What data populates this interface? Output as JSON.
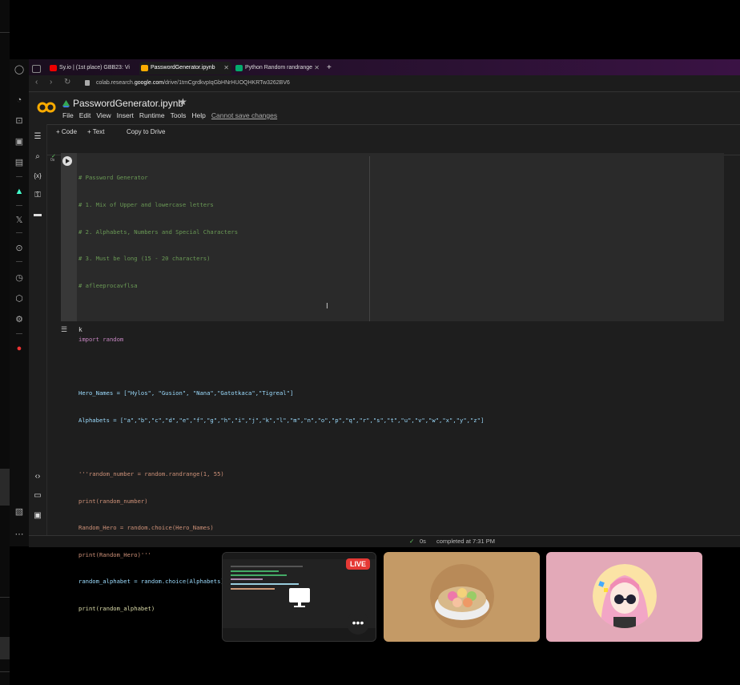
{
  "tabs": [
    {
      "label": "Sy.io | (1st place) GBB23: Vi",
      "active": false
    },
    {
      "label": "PasswordGenerator.ipynb",
      "active": true
    },
    {
      "label": "Python Random randrange",
      "active": false
    }
  ],
  "url": {
    "host_prefix": "colab.research.",
    "host_bold": "google.com",
    "path": "/drive/1tmCgrdkvpIqGbHNrHUOQHKRTw3262BV6"
  },
  "notebook": {
    "title": "PasswordGenerator.ipynb",
    "menu": [
      "File",
      "Edit",
      "View",
      "Insert",
      "Runtime",
      "Tools",
      "Help"
    ],
    "unsaved": "Cannot save changes",
    "toolbar": {
      "code": "+ Code",
      "text": "+ Text",
      "copy": "Copy to Drive"
    },
    "exec_count": "0s",
    "code_lines": [
      "# Password Generator",
      "# 1. Mix of Upper and lowercase letters",
      "# 2. Alphabets, Numbers and Special Characters",
      "# 3. Must be long (15 - 20 characters)",
      "# afleeprocavflsa",
      "",
      "import random",
      "",
      "Hero_Names = [\"Hylos\", \"Gusion\", \"Nana\",\"Gatotkaca\",\"Tigreal\"]",
      "Alphabets = [\"a\",\"b\",\"c\",\"d\",\"e\",\"f\",\"g\",\"h\",\"i\",\"j\",\"k\",\"l\",\"m\",\"n\",\"o\",\"p\",\"q\",\"r\",\"s\",\"t\",\"u\",\"v\",\"w\",\"x\",\"y\",\"z\"]",
      "",
      "'''random_number = random.randrange(1, 55)",
      "print(random_number)",
      "Random_Hero = random.choice(Hero_Names)",
      "print(Random_Hero)'''",
      "random_alphabet = random.choice(Alphabets)",
      "print(random_alphabet)"
    ],
    "output": "k",
    "status": {
      "time": "0s",
      "completed": "completed at 7:31 PM"
    }
  },
  "call": {
    "live_label": "LIVE",
    "more_label": "•••"
  },
  "colors": {
    "accent_orange": "#f9ab00",
    "live": "#e53935"
  }
}
